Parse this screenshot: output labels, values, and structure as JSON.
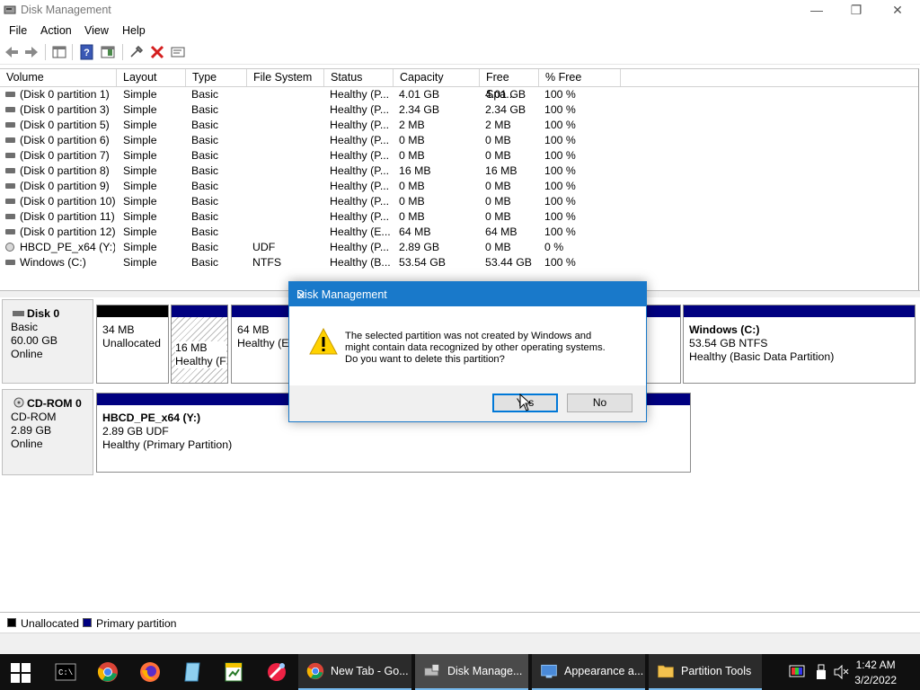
{
  "window": {
    "title": "Disk Management",
    "minimize": "—",
    "restore": "❐",
    "close": "✕"
  },
  "menu": [
    "File",
    "Action",
    "View",
    "Help"
  ],
  "toolbar": {
    "icons": [
      "back-icon",
      "forward-icon",
      "properties-pane-icon",
      "help-icon",
      "details-icon",
      "connect-icon",
      "delete-icon",
      "properties-icon"
    ]
  },
  "columns": [
    "Volume",
    "Layout",
    "Type",
    "File System",
    "Status",
    "Capacity",
    "Free Spa...",
    "% Free"
  ],
  "volumes": [
    {
      "volume": "(Disk 0 partition 1)",
      "layout": "Simple",
      "type": "Basic",
      "fs": "",
      "status": "Healthy (P...",
      "capacity": "4.01 GB",
      "free": "4.01 GB",
      "pct": "100 %",
      "icon": "disk"
    },
    {
      "volume": "(Disk 0 partition 3)",
      "layout": "Simple",
      "type": "Basic",
      "fs": "",
      "status": "Healthy (P...",
      "capacity": "2.34 GB",
      "free": "2.34 GB",
      "pct": "100 %",
      "icon": "disk"
    },
    {
      "volume": "(Disk 0 partition 5)",
      "layout": "Simple",
      "type": "Basic",
      "fs": "",
      "status": "Healthy (P...",
      "capacity": "2 MB",
      "free": "2 MB",
      "pct": "100 %",
      "icon": "disk"
    },
    {
      "volume": "(Disk 0 partition 6)",
      "layout": "Simple",
      "type": "Basic",
      "fs": "",
      "status": "Healthy (P...",
      "capacity": "0 MB",
      "free": "0 MB",
      "pct": "100 %",
      "icon": "disk"
    },
    {
      "volume": "(Disk 0 partition 7)",
      "layout": "Simple",
      "type": "Basic",
      "fs": "",
      "status": "Healthy (P...",
      "capacity": "0 MB",
      "free": "0 MB",
      "pct": "100 %",
      "icon": "disk"
    },
    {
      "volume": "(Disk 0 partition 8)",
      "layout": "Simple",
      "type": "Basic",
      "fs": "",
      "status": "Healthy (P...",
      "capacity": "16 MB",
      "free": "16 MB",
      "pct": "100 %",
      "icon": "disk"
    },
    {
      "volume": "(Disk 0 partition 9)",
      "layout": "Simple",
      "type": "Basic",
      "fs": "",
      "status": "Healthy (P...",
      "capacity": "0 MB",
      "free": "0 MB",
      "pct": "100 %",
      "icon": "disk"
    },
    {
      "volume": "(Disk 0 partition 10)",
      "layout": "Simple",
      "type": "Basic",
      "fs": "",
      "status": "Healthy (P...",
      "capacity": "0 MB",
      "free": "0 MB",
      "pct": "100 %",
      "icon": "disk"
    },
    {
      "volume": "(Disk 0 partition 11)",
      "layout": "Simple",
      "type": "Basic",
      "fs": "",
      "status": "Healthy (P...",
      "capacity": "0 MB",
      "free": "0 MB",
      "pct": "100 %",
      "icon": "disk"
    },
    {
      "volume": "(Disk 0 partition 12)",
      "layout": "Simple",
      "type": "Basic",
      "fs": "",
      "status": "Healthy (E...",
      "capacity": "64 MB",
      "free": "64 MB",
      "pct": "100 %",
      "icon": "disk"
    },
    {
      "volume": "HBCD_PE_x64 (Y:)",
      "layout": "Simple",
      "type": "Basic",
      "fs": "UDF",
      "status": "Healthy (P...",
      "capacity": "2.89 GB",
      "free": "0 MB",
      "pct": "0 %",
      "icon": "cd"
    },
    {
      "volume": "Windows (C:)",
      "layout": "Simple",
      "type": "Basic",
      "fs": "NTFS",
      "status": "Healthy (B...",
      "capacity": "53.54 GB",
      "free": "53.44 GB",
      "pct": "100 %",
      "icon": "disk"
    }
  ],
  "disk0": {
    "name": "Disk 0",
    "kind": "Basic",
    "size": "60.00 GB",
    "state": "Online",
    "partitions": [
      {
        "size": "34 MB",
        "desc": "Unallocated"
      },
      {
        "size": "16 MB",
        "desc": "Healthy (F"
      },
      {
        "size": "64 MB",
        "desc": "Healthy (EF"
      },
      {
        "name": "Windows  (C:)",
        "size": "53.54 GB NTFS",
        "desc": "Healthy (Basic Data Partition)"
      }
    ]
  },
  "cdrom0": {
    "name": "CD-ROM 0",
    "kind": "CD-ROM",
    "size": "2.89 GB",
    "state": "Online",
    "partition": {
      "name": "HBCD_PE_x64  (Y:)",
      "size": "2.89 GB UDF",
      "desc": "Healthy (Primary Partition)"
    }
  },
  "legend": [
    {
      "label": "Unallocated",
      "color": "#000000"
    },
    {
      "label": "Primary partition",
      "color": "#000080"
    }
  ],
  "dialog": {
    "title": "Disk Management",
    "message_lines": [
      "The selected partition was not created by Windows and",
      "might contain data recognized by other operating systems.",
      "Do you want to delete this partition?"
    ],
    "yes_label": "Yes",
    "no_label": "No",
    "close": "✕"
  },
  "taskbar": {
    "tasks": [
      {
        "label": "New Tab - Go...",
        "icon": "chrome-icon"
      },
      {
        "label": "Disk Manage...",
        "icon": "disk-management-icon",
        "active": true
      },
      {
        "label": "Appearance a...",
        "icon": "appearance-icon"
      },
      {
        "label": "Partition Tools",
        "icon": "folder-icon"
      }
    ],
    "time": "1:42 AM",
    "date": "3/2/2022"
  },
  "colors": {
    "primary_partition": "#000080",
    "unallocated": "#000000",
    "dialog_accent": "#1979ca",
    "taskbar": "#101010"
  }
}
